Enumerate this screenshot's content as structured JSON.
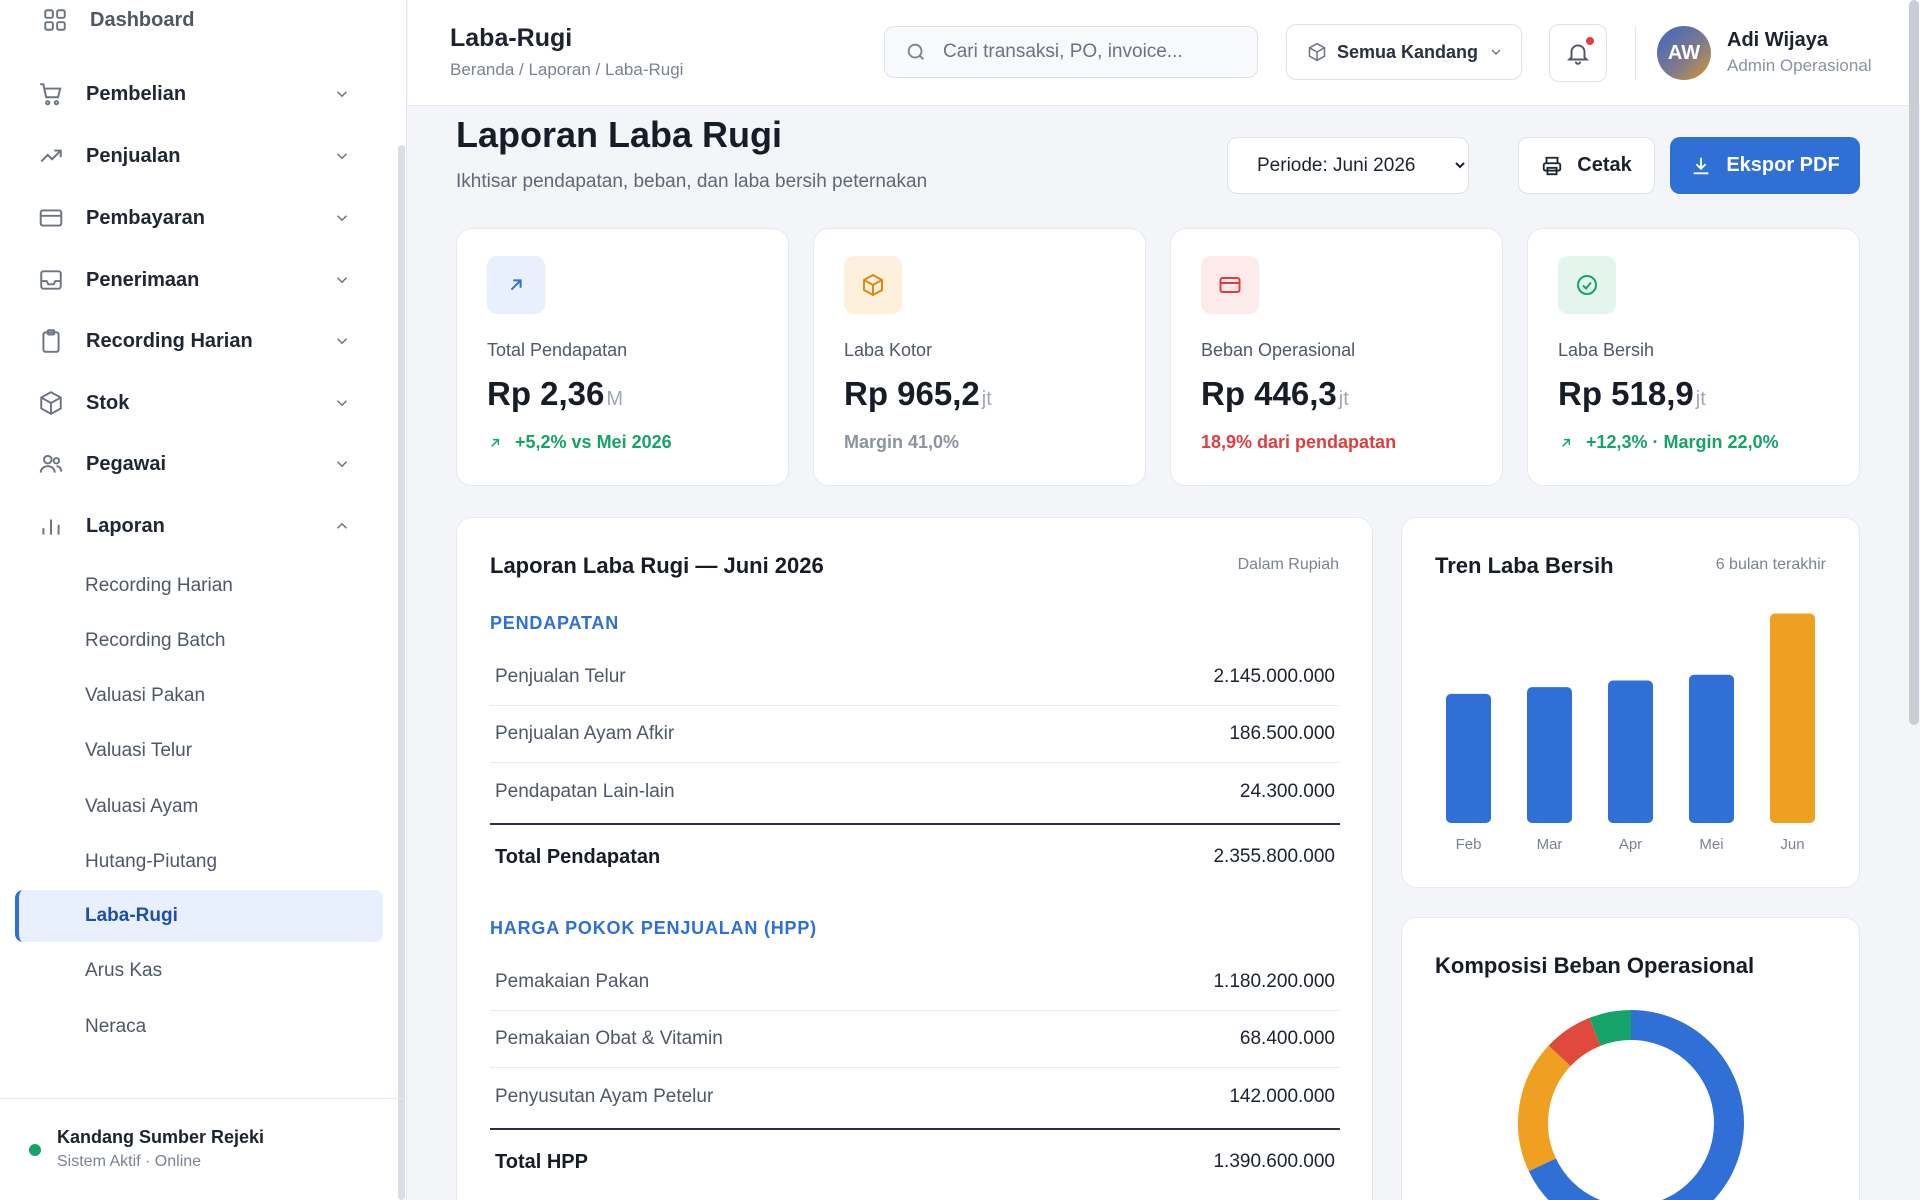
{
  "sidebar": {
    "dashboard": "Dashboard",
    "items": [
      {
        "label": "Pembelian",
        "icon": "cart-icon"
      },
      {
        "label": "Penjualan",
        "icon": "trending-up-icon"
      },
      {
        "label": "Pembayaran",
        "icon": "credit-card-icon"
      },
      {
        "label": "Penerimaan",
        "icon": "inbox-icon"
      },
      {
        "label": "Recording Harian",
        "icon": "clipboard-icon"
      },
      {
        "label": "Stok",
        "icon": "box-icon"
      },
      {
        "label": "Pegawai",
        "icon": "users-icon"
      },
      {
        "label": "Laporan",
        "icon": "bar-chart-icon"
      }
    ],
    "sub_items": [
      "Recording Harian",
      "Recording Batch",
      "Valuasi Pakan",
      "Valuasi Telur",
      "Valuasi Ayam",
      "Hutang-Piutang",
      "Laba-Rugi",
      "Arus Kas",
      "Neraca"
    ],
    "active_sub": "Laba-Rugi",
    "footer": {
      "farm": "Kandang Sumber Rejeki",
      "status": "Sistem Aktif · Online"
    }
  },
  "header": {
    "title": "Laba-Rugi",
    "breadcrumb": "Beranda / Laporan / Laba-Rugi",
    "search_placeholder": "Cari transaksi, PO, invoice...",
    "kandang_label": "Semua Kandang",
    "user": {
      "initials": "AW",
      "name": "Adi Wijaya",
      "role": "Admin Operasional"
    }
  },
  "page": {
    "title": "Laporan Laba Rugi",
    "subtitle": "Ikhtisar pendapatan, beban, dan laba bersih peternakan",
    "periode": "Periode: Juni 2026",
    "print_label": "Cetak",
    "export_label": "Ekspor PDF"
  },
  "kpis": [
    {
      "label": "Total Pendapatan",
      "value": "Rp 2,36",
      "unit": "M",
      "note": "+5,2% vs Mei 2026",
      "note_color": "#16a36a",
      "icon": "arrow-up-right-icon"
    },
    {
      "label": "Laba Kotor",
      "value": "Rp 965,2",
      "unit": "jt",
      "note": "Margin 41,0%",
      "note_color": "#8a93a2",
      "icon": "box-icon"
    },
    {
      "label": "Beban Operasional",
      "value": "Rp 446,3",
      "unit": "jt",
      "note": "18,9% dari pendapatan",
      "note_color": "#e03e3e",
      "icon": "credit-card-icon"
    },
    {
      "label": "Laba Bersih",
      "value": "Rp 518,9",
      "unit": "jt",
      "note": "+12,3% · Margin 22,0%",
      "note_color": "#16a36a",
      "icon": "check-circle-icon"
    }
  ],
  "pl": {
    "title": "Laporan Laba Rugi — Juni 2026",
    "unit_note": "Dalam Rupiah",
    "pendapatan": {
      "section": "PENDAPATAN",
      "rows": [
        {
          "name": "Penjualan Telur",
          "value": "2.145.000.000"
        },
        {
          "name": "Penjualan Ayam Afkir",
          "value": "186.500.000"
        },
        {
          "name": "Pendapatan Lain-lain",
          "value": "24.300.000"
        }
      ],
      "total_label": "Total Pendapatan",
      "total_value": "2.355.800.000"
    },
    "hpp": {
      "section": "HARGA POKOK PENJUALAN (HPP)",
      "rows": [
        {
          "name": "Pemakaian Pakan",
          "value": "1.180.200.000"
        },
        {
          "name": "Pemakaian Obat & Vitamin",
          "value": "68.400.000"
        },
        {
          "name": "Penyusutan Ayam Petelur",
          "value": "142.000.000"
        }
      ],
      "total_label": "Total HPP",
      "total_value": "1.390.600.000"
    }
  },
  "trend": {
    "title": "Tren Laba Bersih",
    "subtitle": "6 bulan terakhir"
  },
  "composition": {
    "title": "Komposisi Beban Operasional"
  },
  "chart_data": [
    {
      "type": "bar",
      "title": "Tren Laba Bersih",
      "categories": [
        "Feb",
        "Mar",
        "Apr",
        "Mei",
        "Jun"
      ],
      "values": [
        435,
        442,
        449,
        455,
        519
      ],
      "ylim": [
        300,
        530
      ],
      "colors": [
        "#2f6fd6",
        "#2f6fd6",
        "#2f6fd6",
        "#2f6fd6",
        "#f0a020"
      ]
    },
    {
      "type": "pie",
      "title": "Komposisi Beban Operasional",
      "values": [
        68,
        19,
        7,
        6
      ],
      "colors": [
        "#2f6fd6",
        "#f0a020",
        "#e04a3c",
        "#16a36a"
      ]
    }
  ]
}
